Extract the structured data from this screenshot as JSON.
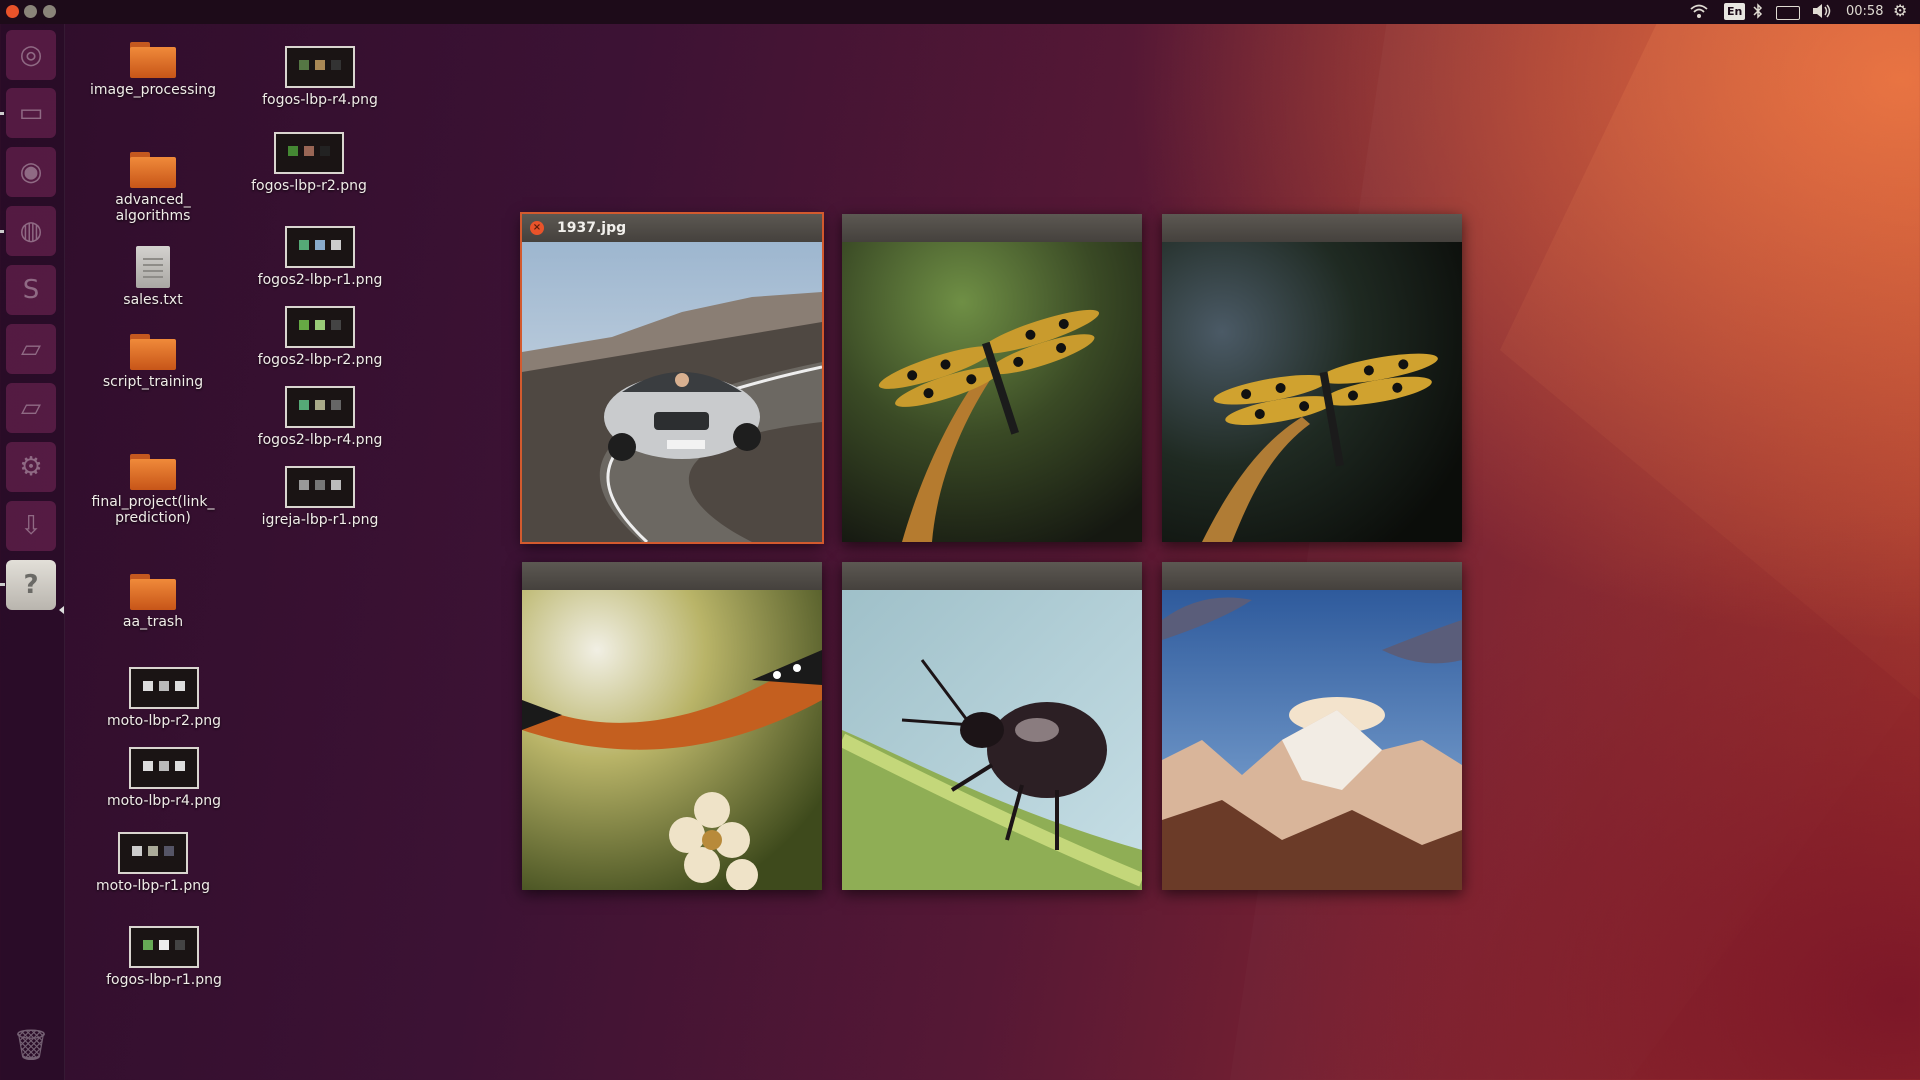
{
  "top_panel": {
    "lang": "En",
    "clock": "00:58"
  },
  "launcher": {
    "items": [
      {
        "name": "dash",
        "glyph": "◎"
      },
      {
        "name": "files",
        "glyph": "▭"
      },
      {
        "name": "browser",
        "glyph": "◉"
      },
      {
        "name": "firefox",
        "glyph": "◍"
      },
      {
        "name": "sublime",
        "glyph": "S"
      },
      {
        "name": "writer",
        "glyph": "▱"
      },
      {
        "name": "calc",
        "glyph": "▱"
      },
      {
        "name": "settings",
        "glyph": "⚙"
      },
      {
        "name": "download",
        "glyph": "⇩"
      },
      {
        "name": "help",
        "glyph": "?"
      }
    ],
    "trash_glyph": "🗑"
  },
  "desktop": {
    "col1": [
      {
        "label": "image_processing",
        "type": "folder"
      },
      {
        "label": "advanced_\nalgorithms",
        "type": "folder"
      },
      {
        "label": "sales.txt",
        "type": "text"
      },
      {
        "label": "script_training",
        "type": "folder"
      },
      {
        "label": "final_project(link_\nprediction)",
        "type": "folder"
      },
      {
        "label": "aa_trash",
        "type": "folder"
      },
      {
        "label": "moto-lbp-r2.png",
        "type": "image"
      },
      {
        "label": "moto-lbp-r4.png",
        "type": "image"
      },
      {
        "label": "moto-lbp-r1.png",
        "type": "image"
      },
      {
        "label": "fogos-lbp-r1.png",
        "type": "image"
      }
    ],
    "col2": [
      {
        "label": "fogos-lbp-r4.png",
        "type": "image"
      },
      {
        "label": "fogos-lbp-r2.png",
        "type": "image"
      },
      {
        "label": "fogos2-lbp-r1.png",
        "type": "image"
      },
      {
        "label": "fogos2-lbp-r2.png",
        "type": "image"
      },
      {
        "label": "fogos2-lbp-r4.png",
        "type": "image"
      },
      {
        "label": "igreja-lbp-r1.png",
        "type": "image"
      }
    ]
  },
  "spread": {
    "focused_title": "1937.jpg",
    "windows": [
      "car",
      "dragonfly-green",
      "dragonfly-dark",
      "butterfly",
      "beetle",
      "mountain"
    ]
  },
  "colors": {
    "accent": "#e9532a",
    "panel": "#1d0b19"
  }
}
